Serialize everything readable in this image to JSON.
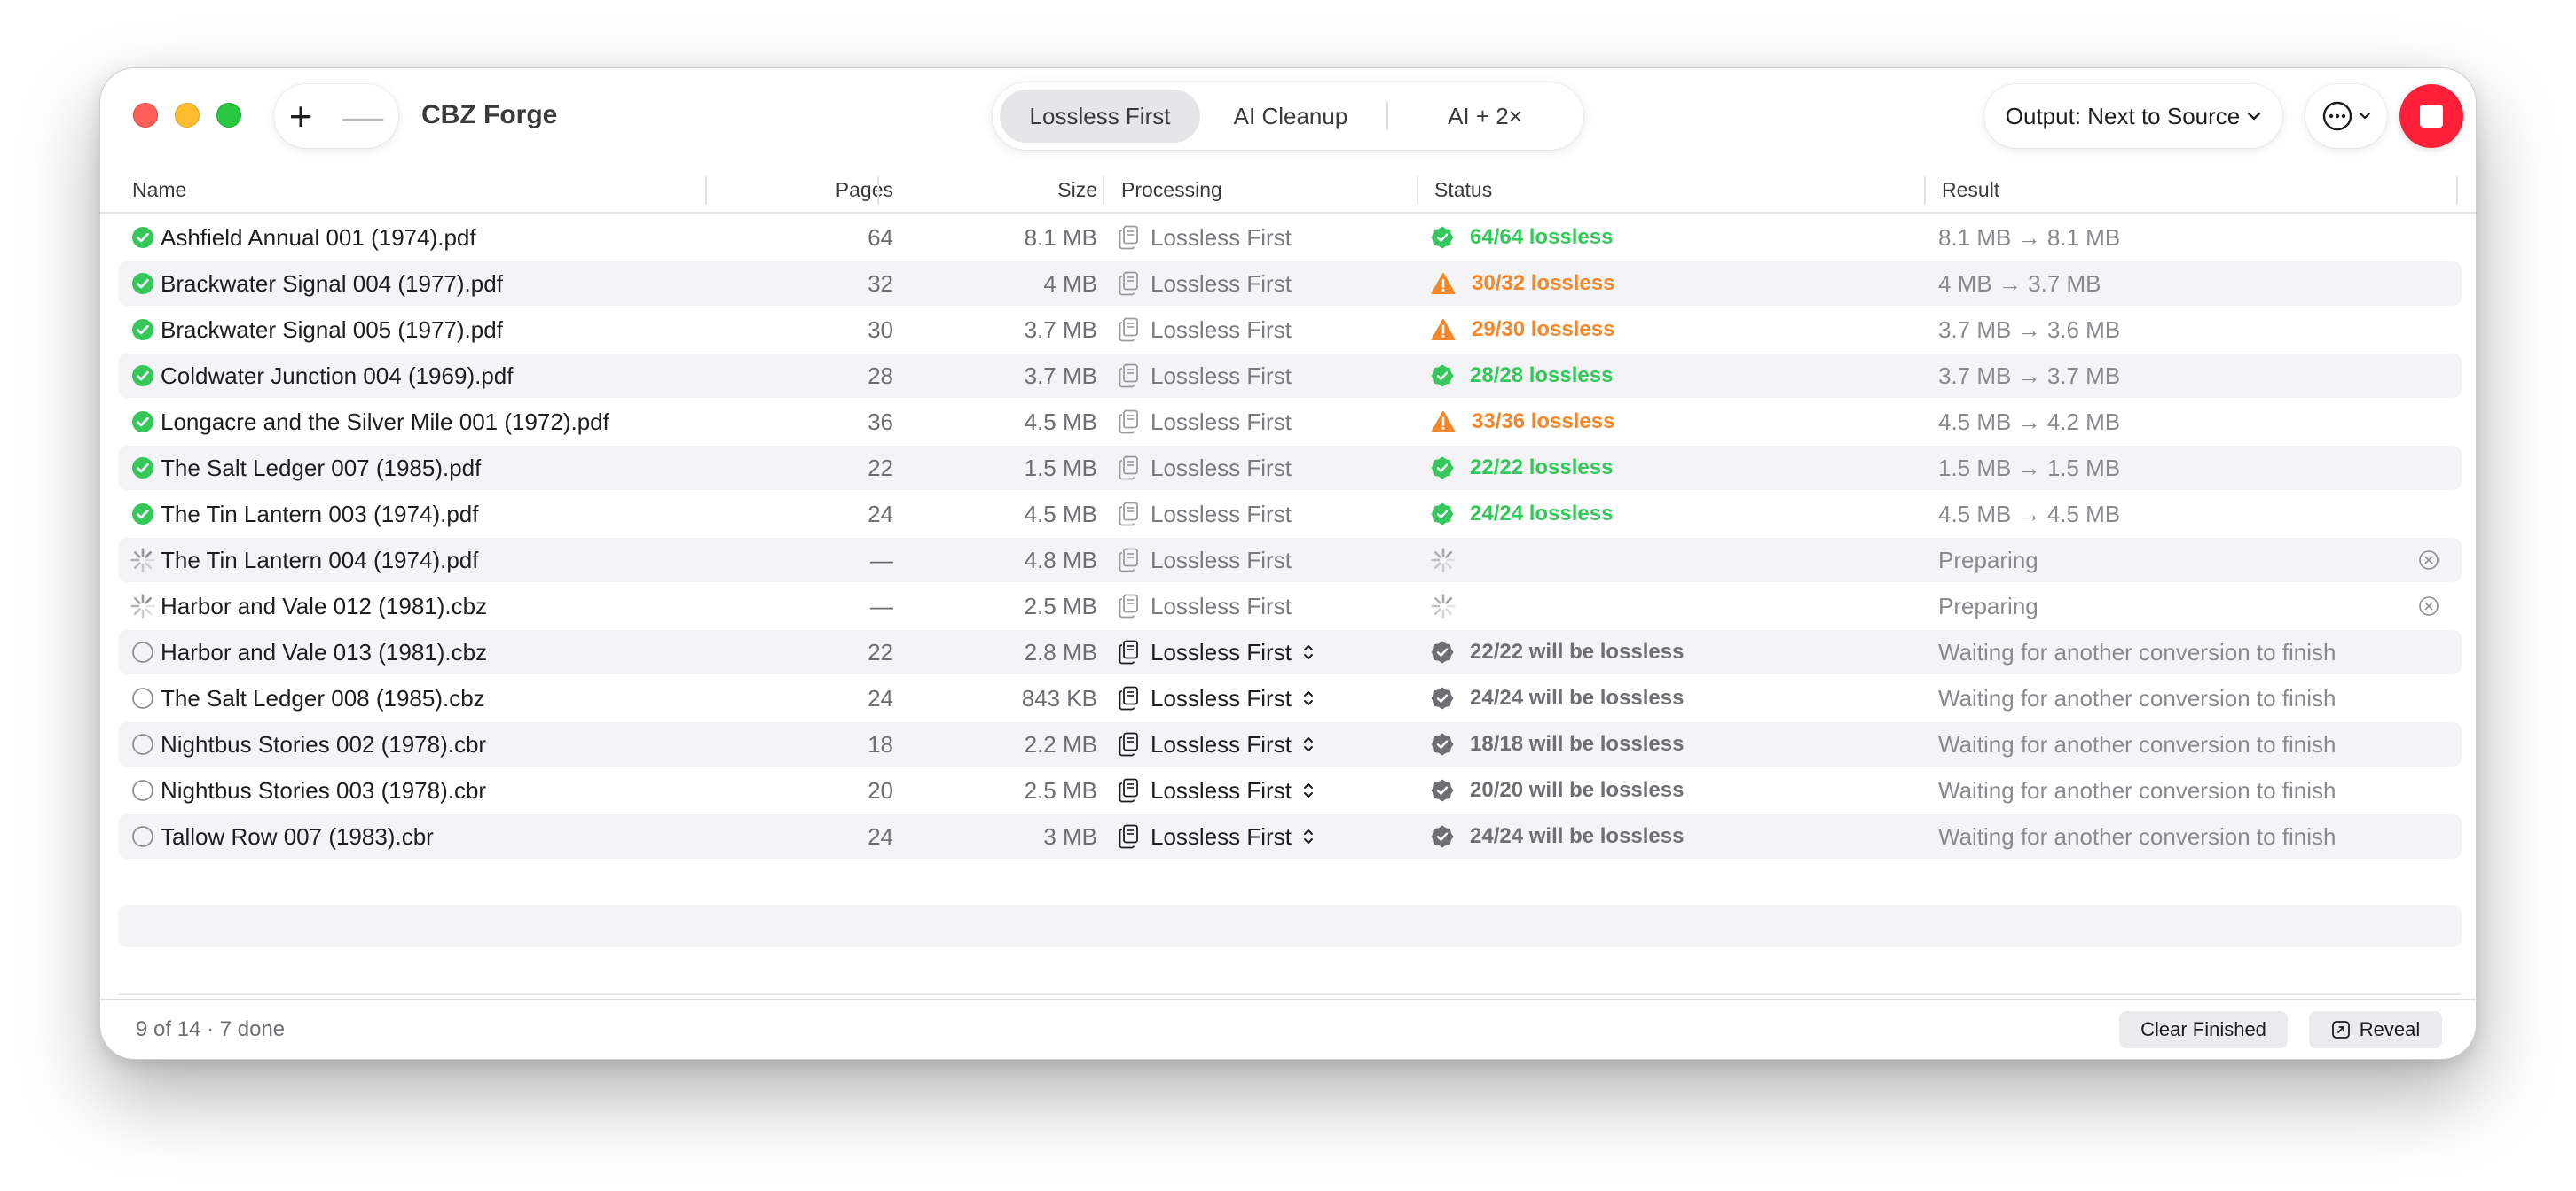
{
  "window": {
    "title": "CBZ Forge"
  },
  "toolbar": {
    "add_label": "+",
    "remove_label": "—",
    "modes": [
      "Lossless First",
      "AI Cleanup",
      "AI + 2×"
    ],
    "active_mode": 0,
    "output_label": "Output: Next to Source"
  },
  "columns": {
    "name": "Name",
    "pages": "Pages",
    "size": "Size",
    "processing": "Processing",
    "status": "Status",
    "result": "Result"
  },
  "rows": [
    {
      "state": "done",
      "name": "Ashfield Annual 001 (1974).pdf",
      "pages": "64",
      "size": "8.1 MB",
      "processing": "Lossless First",
      "proc_menu": false,
      "status_kind": "ok",
      "status": "64/64 lossless",
      "result": "8.1 MB → 8.1 MB"
    },
    {
      "state": "done",
      "name": "Brackwater Signal 004 (1977).pdf",
      "pages": "32",
      "size": "4 MB",
      "processing": "Lossless First",
      "proc_menu": false,
      "status_kind": "warn",
      "status": "30/32 lossless",
      "result": "4 MB → 3.7 MB"
    },
    {
      "state": "done",
      "name": "Brackwater Signal 005 (1977).pdf",
      "pages": "30",
      "size": "3.7 MB",
      "processing": "Lossless First",
      "proc_menu": false,
      "status_kind": "warn",
      "status": "29/30 lossless",
      "result": "3.7 MB → 3.6 MB"
    },
    {
      "state": "done",
      "name": "Coldwater Junction 004 (1969).pdf",
      "pages": "28",
      "size": "3.7 MB",
      "processing": "Lossless First",
      "proc_menu": false,
      "status_kind": "ok",
      "status": "28/28 lossless",
      "result": "3.7 MB → 3.7 MB"
    },
    {
      "state": "done",
      "name": "Longacre and the Silver Mile 001 (1972).pdf",
      "pages": "36",
      "size": "4.5 MB",
      "processing": "Lossless First",
      "proc_menu": false,
      "status_kind": "warn",
      "status": "33/36 lossless",
      "result": "4.5 MB → 4.2 MB"
    },
    {
      "state": "done",
      "name": "The Salt Ledger 007 (1985).pdf",
      "pages": "22",
      "size": "1.5 MB",
      "processing": "Lossless First",
      "proc_menu": false,
      "status_kind": "ok",
      "status": "22/22 lossless",
      "result": "1.5 MB → 1.5 MB"
    },
    {
      "state": "done",
      "name": "The Tin Lantern 003 (1974).pdf",
      "pages": "24",
      "size": "4.5 MB",
      "processing": "Lossless First",
      "proc_menu": false,
      "status_kind": "ok",
      "status": "24/24 lossless",
      "result": "4.5 MB → 4.5 MB"
    },
    {
      "state": "active",
      "name": "The Tin Lantern 004 (1974).pdf",
      "pages": "—",
      "size": "4.8 MB",
      "processing": "Lossless First",
      "proc_menu": false,
      "status_kind": "spin",
      "status": "",
      "result": "Preparing"
    },
    {
      "state": "active",
      "name": "Harbor and Vale 012 (1981).cbz",
      "pages": "—",
      "size": "2.5 MB",
      "processing": "Lossless First",
      "proc_menu": false,
      "status_kind": "spin",
      "status": "",
      "result": "Preparing"
    },
    {
      "state": "queued",
      "name": "Harbor and Vale 013 (1981).cbz",
      "pages": "22",
      "size": "2.8 MB",
      "processing": "Lossless First",
      "proc_menu": true,
      "status_kind": "pending",
      "status": "22/22 will be lossless",
      "result": "Waiting for another conversion to finish"
    },
    {
      "state": "queued",
      "name": "The Salt Ledger 008 (1985).cbz",
      "pages": "24",
      "size": "843 KB",
      "processing": "Lossless First",
      "proc_menu": true,
      "status_kind": "pending",
      "status": "24/24 will be lossless",
      "result": "Waiting for another conversion to finish"
    },
    {
      "state": "queued",
      "name": "Nightbus Stories 002 (1978).cbr",
      "pages": "18",
      "size": "2.2 MB",
      "processing": "Lossless First",
      "proc_menu": true,
      "status_kind": "pending",
      "status": "18/18 will be lossless",
      "result": "Waiting for another conversion to finish"
    },
    {
      "state": "queued",
      "name": "Nightbus Stories 003 (1978).cbr",
      "pages": "20",
      "size": "2.5 MB",
      "processing": "Lossless First",
      "proc_menu": true,
      "status_kind": "pending",
      "status": "20/20 will be lossless",
      "result": "Waiting for another conversion to finish"
    },
    {
      "state": "queued",
      "name": "Tallow Row 007 (1983).cbr",
      "pages": "24",
      "size": "3 MB",
      "processing": "Lossless First",
      "proc_menu": true,
      "status_kind": "pending",
      "status": "24/24 will be lossless",
      "result": "Waiting for another conversion to finish"
    }
  ],
  "footer": {
    "summary": "9 of 14 · 7 done",
    "clear_label": "Clear Finished",
    "reveal_label": "Reveal"
  },
  "colors": {
    "success": "#34c759",
    "warning": "#f5862a",
    "stop": "#ff1f38",
    "close": "#ff5f57",
    "minimize": "#febc2e",
    "maximize": "#28c840"
  },
  "icons": {
    "done": "check-circle-icon",
    "active": "spinner-icon",
    "queued": "empty-circle-icon",
    "processing": "document-stack-icon",
    "status_ok": "check-seal-icon",
    "status_warn": "warning-triangle-icon",
    "status_pending": "check-seal-icon",
    "cancel": "x-circle-icon",
    "stop": "stop-icon",
    "more": "ellipsis-circle-icon",
    "reveal": "arrow-up-right-square-icon"
  }
}
